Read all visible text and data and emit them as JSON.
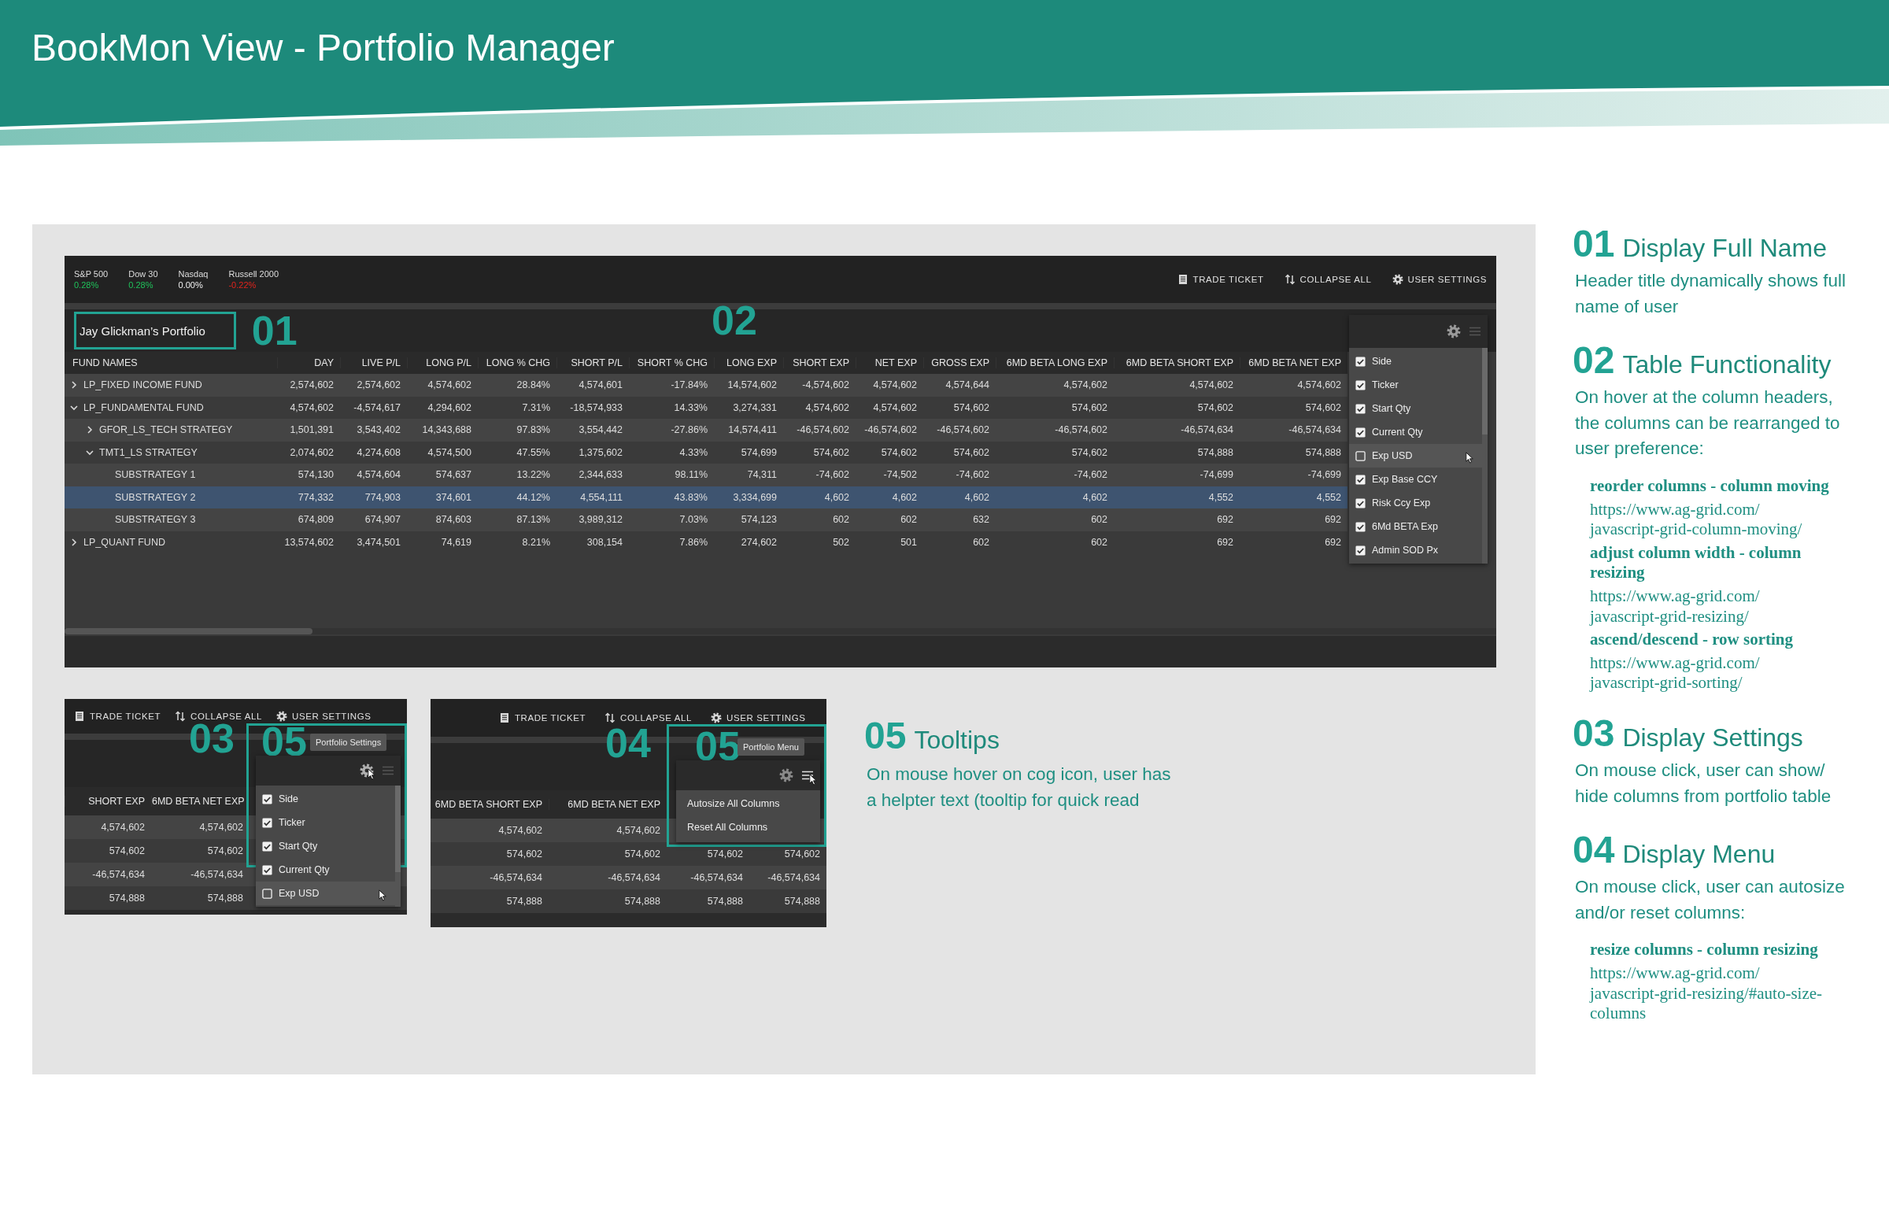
{
  "header": {
    "title": "BookMon View - Portfolio Manager"
  },
  "main_screen": {
    "indices": [
      {
        "name": "S&P 500",
        "change": "0.28%",
        "color": "#1fc15a"
      },
      {
        "name": "Dow 30",
        "change": "0.28%",
        "color": "#1fc15a"
      },
      {
        "name": "Nasdaq",
        "change": "0.00%",
        "color": "#f0f0f0"
      },
      {
        "name": "Russell 2000",
        "change": "-0.22%",
        "color": "#e3241c"
      }
    ],
    "toolbar": [
      "TRADE TICKET",
      "COLLAPSE ALL",
      "USER SETTINGS"
    ],
    "portfolio_title": "Jay Glickman’s Portfolio",
    "callouts": [
      "01",
      "02"
    ],
    "columns": [
      "FUND NAMES",
      "DAY",
      "LIVE P/L",
      "LONG P/L",
      "LONG % CHG",
      "SHORT P/L",
      "SHORT % CHG",
      "LONG EXP",
      "SHORT EXP",
      "NET EXP",
      "GROSS EXP",
      "6MD BETA LONG EXP",
      "6MD BETA SHORT EXP",
      "6MD BETA NET EXP"
    ],
    "rows": [
      {
        "name": "LP_FIXED INCOME FUND",
        "kind": "group",
        "expanded": false,
        "selected": false,
        "values": [
          "2,574,602",
          "2,574,602",
          "4,574,602",
          "28.84%",
          "4,574,601",
          "-17.84%",
          "14,574,602",
          "-4,574,602",
          "4,574,602",
          "4,574,644",
          "4,574,602",
          "4,574,602",
          "4,574,602"
        ]
      },
      {
        "name": "LP_FUNDAMENTAL FUND",
        "kind": "group",
        "expanded": true,
        "selected": false,
        "values": [
          "4,574,602",
          "-4,574,617",
          "4,294,602",
          "7.31%",
          "-18,574,933",
          "14.33%",
          "3,274,331",
          "4,574,602",
          "4,574,602",
          "574,602",
          "574,602",
          "574,602",
          "574,602"
        ],
        "children": [
          {
            "name": "GFOR_LS_TECH STRATEGY",
            "kind": "group",
            "expanded": false,
            "selected": false,
            "values": [
              "1,501,391",
              "3,543,402",
              "14,343,688",
              "97.83%",
              "3,554,442",
              "-27.86%",
              "14,574,411",
              "-46,574,602",
              "-46,574,602",
              "-46,574,602",
              "-46,574,602",
              "-46,574,634",
              "-46,574,634"
            ]
          },
          {
            "name": "TMT1_LS STRATEGY",
            "kind": "group",
            "expanded": true,
            "selected": false,
            "values": [
              "2,074,602",
              "4,274,608",
              "4,574,500",
              "47.55%",
              "1,375,602",
              "4.33%",
              "574,699",
              "574,602",
              "574,602",
              "574,602",
              "574,602",
              "574,888",
              "574,888"
            ],
            "children": [
              {
                "name": "SUBSTRATEGY 1",
                "kind": "leaf",
                "selected": false,
                "values": [
                  "574,130",
                  "4,574,604",
                  "574,637",
                  "13.22%",
                  "2,344,633",
                  "98.11%",
                  "74,311",
                  "-74,602",
                  "-74,502",
                  "-74,602",
                  "-74,602",
                  "-74,699",
                  "-74,699"
                ]
              },
              {
                "name": "SUBSTRATEGY 2",
                "kind": "leaf",
                "selected": true,
                "values": [
                  "774,332",
                  "774,903",
                  "374,601",
                  "44.12%",
                  "4,554,111",
                  "43.83%",
                  "3,334,699",
                  "4,602",
                  "4,602",
                  "4,602",
                  "4,602",
                  "4,552",
                  "4,552"
                ]
              },
              {
                "name": "SUBSTRATEGY 3",
                "kind": "leaf",
                "selected": false,
                "values": [
                  "674,809",
                  "674,907",
                  "874,603",
                  "87.13%",
                  "3,989,312",
                  "7.03%",
                  "574,123",
                  "602",
                  "602",
                  "632",
                  "602",
                  "692",
                  "692"
                ]
              }
            ]
          }
        ]
      },
      {
        "name": "LP_QUANT FUND",
        "kind": "group",
        "expanded": false,
        "selected": false,
        "values": [
          "13,574,602",
          "3,474,501",
          "74,619",
          "8.21%",
          "308,154",
          "7.86%",
          "274,602",
          "502",
          "501",
          "602",
          "602",
          "692",
          "692"
        ]
      }
    ],
    "column_menu": {
      "items": [
        {
          "label": "Side",
          "checked": true,
          "hovered": false
        },
        {
          "label": "Ticker",
          "checked": true,
          "hovered": false
        },
        {
          "label": "Start Qty",
          "checked": true,
          "hovered": false
        },
        {
          "label": "Current Qty",
          "checked": true,
          "hovered": false
        },
        {
          "label": "Exp USD",
          "checked": false,
          "hovered": true
        },
        {
          "label": "Exp Base CCY",
          "checked": true,
          "hovered": false
        },
        {
          "label": "Risk Ccy Exp",
          "checked": true,
          "hovered": false
        },
        {
          "label": "6Md BETA Exp",
          "checked": true,
          "hovered": false
        },
        {
          "label": "Admin SOD Px",
          "checked": true,
          "hovered": false
        }
      ]
    }
  },
  "detail_shots": [
    {
      "toolbar": [
        "TRADE TICKET",
        "COLLAPSE ALL",
        "USER SETTINGS"
      ],
      "callouts": [
        "03",
        "05"
      ],
      "tooltip": "Portfolio Settings",
      "columns": [
        "SHORT EXP",
        "6MD BETA NET EXP"
      ],
      "rows": [
        [
          "4,574,602",
          "4,574,602"
        ],
        [
          "574,602",
          "574,602"
        ],
        [
          "-46,574,634",
          "-46,574,634"
        ],
        [
          "574,888",
          "574,888"
        ]
      ],
      "menu": {
        "kind": "checklist",
        "icons": [
          {
            "kind": "gear",
            "hovered": true
          },
          {
            "kind": "menu",
            "hovered": false
          }
        ],
        "items": [
          {
            "label": "Side",
            "checked": true,
            "hovered": false
          },
          {
            "label": "Ticker",
            "checked": true,
            "hovered": false
          },
          {
            "label": "Start Qty",
            "checked": true,
            "hovered": false
          },
          {
            "label": "Current Qty",
            "checked": true,
            "hovered": false
          },
          {
            "label": "Exp USD",
            "checked": false,
            "hovered": true
          }
        ]
      }
    },
    {
      "toolbar": [
        "TRADE TICKET",
        "COLLAPSE ALL",
        "USER SETTINGS"
      ],
      "callouts": [
        "04",
        "05"
      ],
      "tooltip": "Portfolio Menu",
      "columns": [
        "6MD BETA SHORT EXP",
        "6MD BETA NET EXP"
      ],
      "rows": [
        [
          "4,574,602",
          "4,574,602"
        ],
        [
          "574,602",
          "574,602",
          "574,602",
          "574,602"
        ],
        [
          "-46,574,634",
          "-46,574,634",
          "-46,574,634",
          "-46,574,634"
        ],
        [
          "574,888",
          "574,888",
          "574,888",
          "574,888"
        ]
      ],
      "menu": {
        "kind": "actions",
        "icons": [
          {
            "kind": "gear",
            "hovered": false
          },
          {
            "kind": "menu",
            "hovered": true
          }
        ],
        "items": [
          {
            "label": "Autosize All Columns"
          },
          {
            "label": "Reset All Columns"
          }
        ]
      }
    }
  ],
  "tooltip_note": {
    "number": "05",
    "title": "Tooltips",
    "text": "On mouse hover on cog icon, user has a helpter text (tooltip for quick read"
  },
  "notes": [
    {
      "number": "01",
      "title": "Display Full Name",
      "text": "Header title dynamically shows full name of user"
    },
    {
      "number": "02",
      "title": "Table Functionality",
      "text": "On hover at the column headers, the columns can be rearranged to user preference:",
      "links": [
        {
          "label": "reorder columns - column moving",
          "url": "https://www.ag-grid.com/javascript-grid-column-moving/"
        },
        {
          "label": "adjust column width - column resizing",
          "url": "https://www.ag-grid.com/javascript-grid-resizing/"
        },
        {
          "label": "ascend/descend - row sorting",
          "url": "https://www.ag-grid.com/javascript-grid-sorting/"
        }
      ]
    },
    {
      "number": "03",
      "title": "Display Settings",
      "text": "On mouse click, user can show/ hide columns from portfolio table"
    },
    {
      "number": "04",
      "title": "Display Menu",
      "text": "On mouse click, user can autosize and/or reset columns:",
      "links": [
        {
          "label": "resize columns - column resizing",
          "url": "https://www.ag-grid.com/javascript-grid-resizing/#auto-size-columns"
        }
      ]
    }
  ]
}
